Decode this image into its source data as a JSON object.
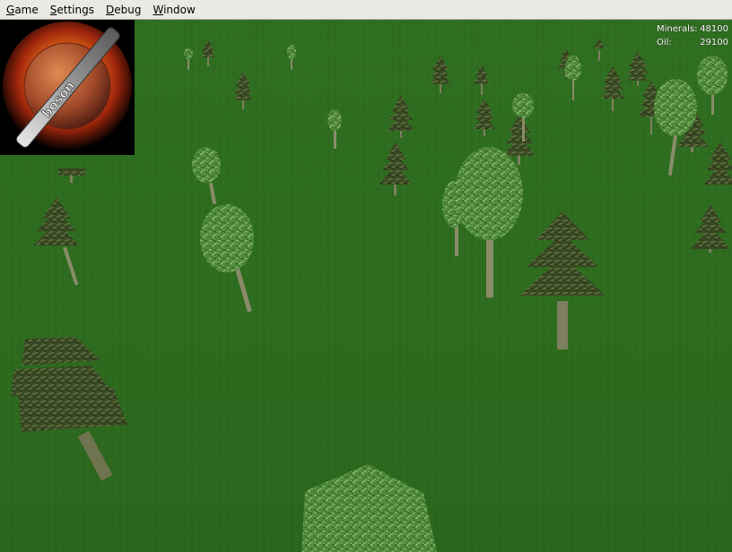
{
  "menubar": {
    "items": [
      {
        "mnemonic": "G",
        "rest": "ame"
      },
      {
        "mnemonic": "S",
        "rest": "ettings"
      },
      {
        "mnemonic": "D",
        "rest": "ebug"
      },
      {
        "mnemonic": "W",
        "rest": "indow"
      }
    ]
  },
  "resources": {
    "minerals_label": "Minerals:",
    "minerals_value": "48100",
    "oil_label": "Oil:",
    "oil_value": "29100"
  },
  "logo": {
    "text": "boson"
  },
  "colors": {
    "grass": "#2c6a1f",
    "pine_foliage": "#3a4a24",
    "deciduous_foliage": "#4f8a3a",
    "trunk": "#8a8c6a",
    "menubar_bg": "#ebe9e4",
    "hud_text": "#ffffff"
  }
}
